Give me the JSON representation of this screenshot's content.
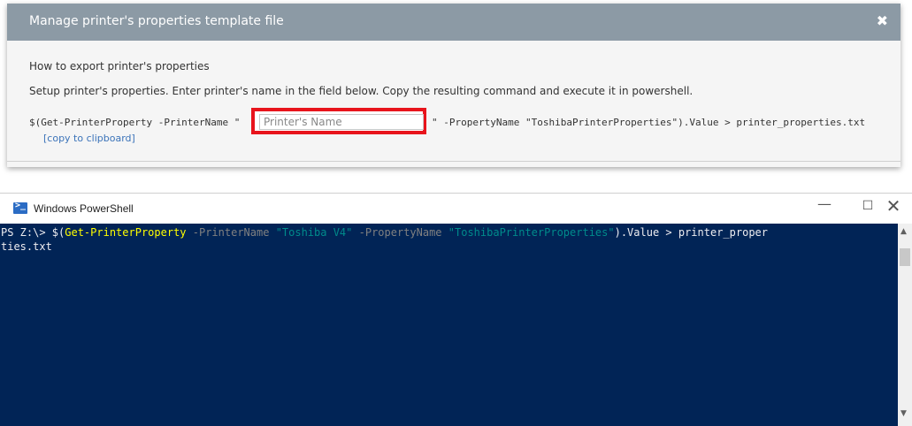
{
  "dialog": {
    "title": "Manage printer's properties template file",
    "close_glyph": "✖",
    "heading": "How to export printer's properties",
    "instructions": "Setup printer's properties. Enter printer's name in the field below. Copy the resulting command and execute it in powershell.",
    "command_prefix": "$(Get-PrinterProperty -PrinterName \"",
    "printer_name_placeholder": "Printer's Name",
    "printer_name_value": "",
    "command_suffix": "\" -PropertyName \"ToshibaPrinterProperties\").Value > printer_properties.txt",
    "copy_link": "[copy to clipboard]"
  },
  "powershell": {
    "window_title": "Windows PowerShell",
    "logo_glyph": ">_",
    "min_glyph": "—",
    "max_glyph": "☐",
    "close_glyph": "✕",
    "console": {
      "prompt": "PS Z:\\> ",
      "dollar_paren": "$(",
      "cmdlet": "Get-PrinterProperty",
      "param1": " -PrinterName ",
      "arg1": "\"Toshiba V4\"",
      "param2": " -PropertyName ",
      "arg2": "\"ToshibaPrinterProperties\"",
      "tail": ").Value > printer_proper",
      "wrap": "ties.txt"
    },
    "scroll_up": "▲",
    "scroll_down": "▼"
  },
  "colors": {
    "dialog_header": "#8c9aa5",
    "highlight_border": "#e8141c",
    "console_bg": "#012456",
    "link": "#3b73b9"
  }
}
